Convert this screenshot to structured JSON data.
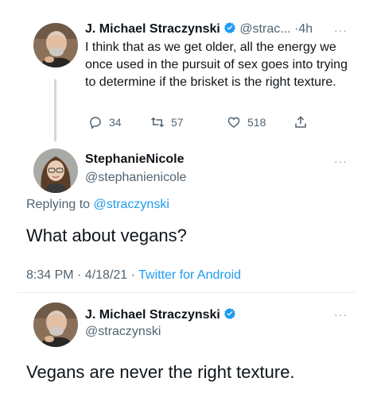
{
  "tweet1": {
    "name": "J. Michael Straczynski",
    "handle": "@strac...",
    "sep": "·",
    "time": "4h",
    "more": "···",
    "text": "I think that as we get older, all the energy we once used in the pursuit of sex goes into trying to determine if the brisket is the right texture.",
    "replies": "34",
    "retweets": "57",
    "likes": "518"
  },
  "tweet2": {
    "name": "StephanieNicole",
    "handle": "@stephanienicole",
    "more": "···",
    "replying_prefix": "Replying to",
    "replying_to": "@straczynski",
    "text": "What about vegans?",
    "timestamp": "8:34 PM · 4/18/21 · ",
    "app": "Twitter for Android"
  },
  "tweet3": {
    "name": "J. Michael Straczynski",
    "handle": "@straczynski",
    "more": "···",
    "text": "Vegans are never the right texture."
  },
  "colors": {
    "verified": "#1d9bf0",
    "link": "#1d9bf0",
    "secondary_text": "#536471",
    "thread_line": "#cfd9de"
  },
  "icons": [
    "verified-badge-icon",
    "reply-icon",
    "retweet-icon",
    "like-icon",
    "share-icon",
    "more-icon"
  ]
}
